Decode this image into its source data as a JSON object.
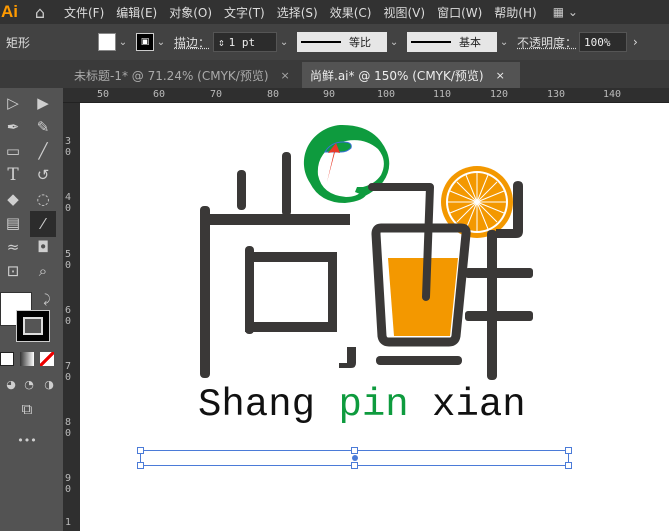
{
  "app": {
    "logo": "Ai",
    "menus": [
      "文件(F)",
      "编辑(E)",
      "对象(O)",
      "文字(T)",
      "选择(S)",
      "效果(C)",
      "视图(V)",
      "窗口(W)",
      "帮助(H)"
    ]
  },
  "control": {
    "object_type": "矩形",
    "stroke_label": "描边：",
    "stroke_value": "1 pt",
    "profile1": "等比",
    "profile2": "基本",
    "opacity_label": "不透明度：",
    "opacity_value": "100%"
  },
  "tabs": [
    {
      "label": "未标题-1* @ 71.24% (CMYK/预览)",
      "close": "×"
    },
    {
      "label": "尚鲜.ai* @ 150% (CMYK/预览)",
      "close": "×"
    }
  ],
  "ruler": {
    "top": [
      "50",
      "60",
      "70",
      "80",
      "90",
      "100",
      "110",
      "120",
      "130",
      "140"
    ],
    "left": [
      "3\n0",
      "4\n0",
      "5\n0",
      "6\n0",
      "7\n0",
      "8\n0",
      "9\n0",
      "1"
    ]
  },
  "artwork": {
    "logo_text": "尚鲜",
    "slogan_1": "Shang ",
    "slogan_2": "pin",
    "slogan_3": " xian",
    "colors": {
      "dark": "#3a3837",
      "green": "#0e9b3e",
      "orange": "#f39800",
      "red": "#e83828"
    }
  }
}
